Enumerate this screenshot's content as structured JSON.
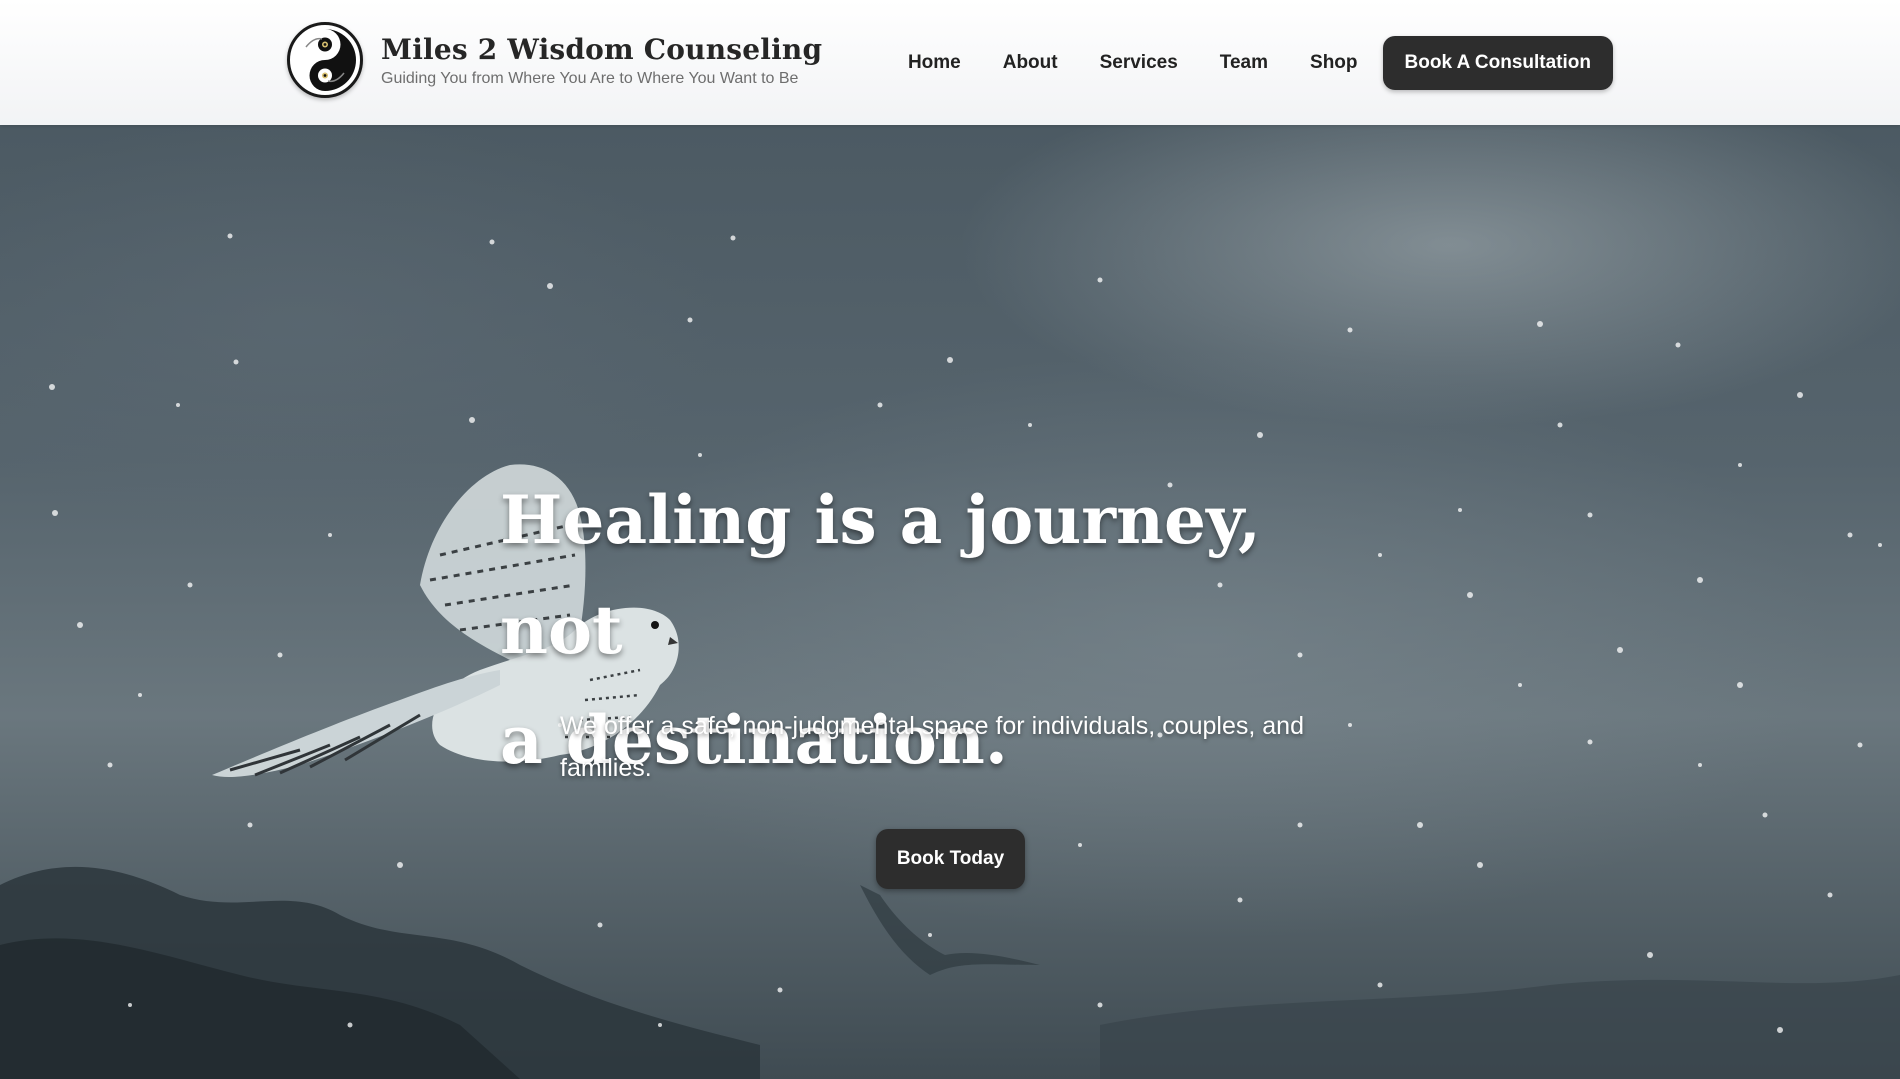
{
  "brand": {
    "logo_icon": "owl-yin-yang-logo-icon",
    "name": "Miles 2 Wisdom Counseling",
    "tagline": "Guiding You from Where You Are to Where You Want to Be"
  },
  "nav": {
    "items": [
      {
        "label": "Home"
      },
      {
        "label": "About"
      },
      {
        "label": "Services"
      },
      {
        "label": "Team"
      },
      {
        "label": "Shop"
      }
    ],
    "cta_label": "Book A Consultation"
  },
  "hero": {
    "title_line1": "Healing is a journey, not",
    "title_line2": "a destination.",
    "subtitle": "We offer a safe, non-judgmental space for individuals, couples, and families.",
    "button_label": "Book Today",
    "image_icon": "snowy-owl-flight-background"
  },
  "colors": {
    "button_bg": "#2d2d2d",
    "header_bg": "#ffffff",
    "hero_overlay": "#4c5a63"
  }
}
